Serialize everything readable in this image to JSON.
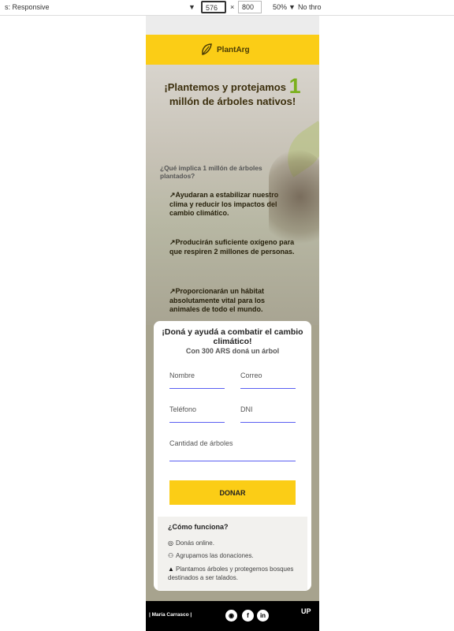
{
  "devtools": {
    "device": "s: Responsive",
    "width": "576",
    "times": "×",
    "height": "800",
    "zoom": "50%",
    "throttle": "No thro"
  },
  "brand": {
    "name": "PlantArg"
  },
  "hero": {
    "title_prefix": "¡Plantemos y protejamos",
    "title_number": "1",
    "title_suffix": "millón de árboles nativos!",
    "question": "¿Qué implica 1 millón de árboles plantados?",
    "bullet_icon": "↗",
    "bullets": [
      "Ayudaran a estabilizar nuestro clima y reducir los impactos del cambio climático.",
      "Producirán suficiente oxígeno para que respiren 2 millones de personas.",
      "Proporcionarán un hábitat absolutamente vital para los animales de todo el mundo."
    ]
  },
  "form": {
    "title": "¡Doná y ayudá a combatir el cambio climático!",
    "note": "Con 300 ARS doná un árbol",
    "name_placeholder": "Nombre",
    "email_placeholder": "Correo",
    "phone_placeholder": "Teléfono",
    "dni_placeholder": "DNI",
    "trees_placeholder": "Cantidad de árboles",
    "donate_label": "DONAR"
  },
  "how": {
    "title": "¿Cómo funciona?",
    "items": [
      {
        "icon": "globe-icon",
        "text": "Donás online."
      },
      {
        "icon": "people-icon",
        "text": "Agrupamos las donaciones."
      },
      {
        "icon": "tree-icon",
        "text": "Plantamos árboles y protegemos bosques destinados a ser talados."
      }
    ]
  },
  "footer": {
    "name": "| María Carrasco |",
    "social": [
      "instagram-icon",
      "facebook-icon",
      "linkedin-icon"
    ],
    "logo_text": "UP"
  },
  "colors": {
    "brand_yellow": "#fbcd16",
    "accent_green": "#7bb01e",
    "input_line": "#5a5ff2",
    "footer": "#000000"
  }
}
